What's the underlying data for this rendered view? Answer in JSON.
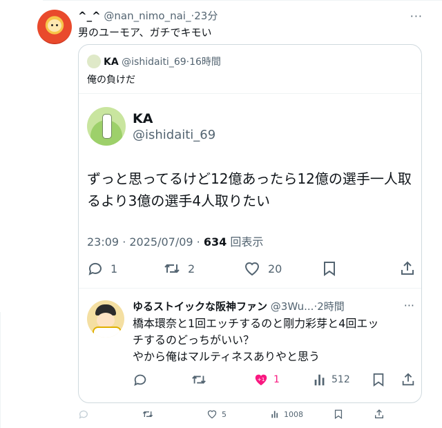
{
  "post": {
    "display_name": "^_^",
    "handle": "@nan_nimo_nai_",
    "separator": "·",
    "time": "23分",
    "text": "男のユーモア、ガチでキモい",
    "more_icon": "more-icon"
  },
  "quote": {
    "display_name": "KA",
    "handle": "@ishidaiti_69",
    "separator": "·",
    "time": "16時間",
    "text": "俺の負けだ"
  },
  "quoted_tweet": {
    "display_name": "KA",
    "handle": "@ishidaiti_69",
    "text": "ずっと思ってるけど12億あったら12億の選手一人取るより3億の選手4人取りたい",
    "timestamp": "23:09 · 2025/07/09 · ",
    "views_count": "634",
    "views_label": "回表示",
    "actions": {
      "reply_count": "1",
      "retweet_count": "2",
      "like_count": "20"
    }
  },
  "reply": {
    "display_name": "ゆるストイックな阪神ファン",
    "handle": "@3Wu...",
    "separator": "·",
    "time": "2時間",
    "text_line1": "橋本環奈と1回エッチするのと剛力彩芽と4回エッ",
    "text_line2": "チするのどっちがいい？",
    "text_line3": "やから俺はマルティネスありやと思う",
    "actions": {
      "like_badge": "+1",
      "like_count": "1",
      "views_count": "512"
    }
  },
  "outer_actions": {
    "like_count": "5",
    "views_count": "1008"
  },
  "colors": {
    "text": "#0f1419",
    "muted": "#536471",
    "border": "#cfd9de",
    "like": "#f91880"
  }
}
